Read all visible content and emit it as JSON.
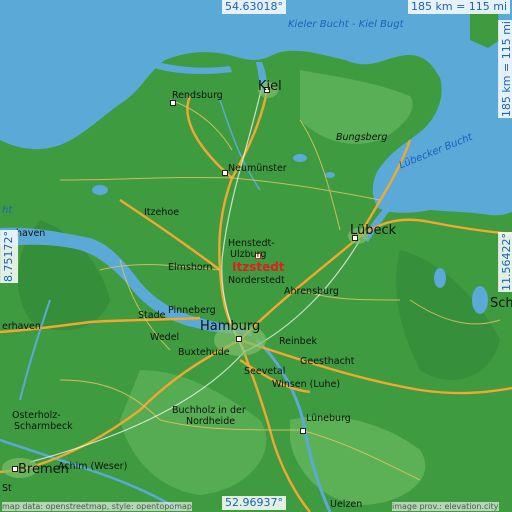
{
  "coords": {
    "top": "54.63018°",
    "bottom": "52.96937°",
    "left": "8.75172°",
    "right": "11.56422°",
    "scale_top": "185 km = 115 mi",
    "scale_right": "185 km = 115 mi"
  },
  "water": {
    "kiel_bay": "Kieler Bucht - Kiel Bugt",
    "lubeck_bay": "Lübecker Bucht",
    "left_partial": "ht"
  },
  "highlight": "Itzstedt",
  "places": {
    "kiel": "Kiel",
    "rendsburg": "Rendsburg",
    "neumunster": "Neumünster",
    "bungsberg": "Bungsberg",
    "itzehoe": "Itzehoe",
    "lubeck": "Lübeck",
    "henstedt": "Henstedt-",
    "ulzburg": "Ulzburg",
    "elmshorn": "Elmshorn",
    "norderstedt": "Norderstedt",
    "ahrensburg": "Ahrensburg",
    "haven": "haven",
    "hamburg": "Hamburg",
    "pinneberg": "Pinneberg",
    "stade": "Stade",
    "wedel": "Wedel",
    "erhaven": "erhaven",
    "reinbek": "Reinbek",
    "buxtehude": "Buxtehude",
    "geesthacht": "Geesthacht",
    "seevetal": "Seevetal",
    "winsen": "Winsen (Luhe)",
    "osterholz": "Osterholz-",
    "scharmbeck": "Scharmbeck",
    "buchholz": "Buchholz in der",
    "nordheide": "Nordheide",
    "luneburg": "Lüneburg",
    "bremen": "Bremen",
    "achim": "Achim (Weser)",
    "uelzen": "Uelzen",
    "schw": "Sch",
    "st": "St"
  },
  "attribution": {
    "left": "map data: openstreetmap, style: opentopomap",
    "right": "image prov.: elevation.city"
  },
  "colors": {
    "water": "#5aa9d6",
    "land": "#3e9a3e",
    "highway": "#f0a830",
    "marker": "#e01f1f"
  }
}
